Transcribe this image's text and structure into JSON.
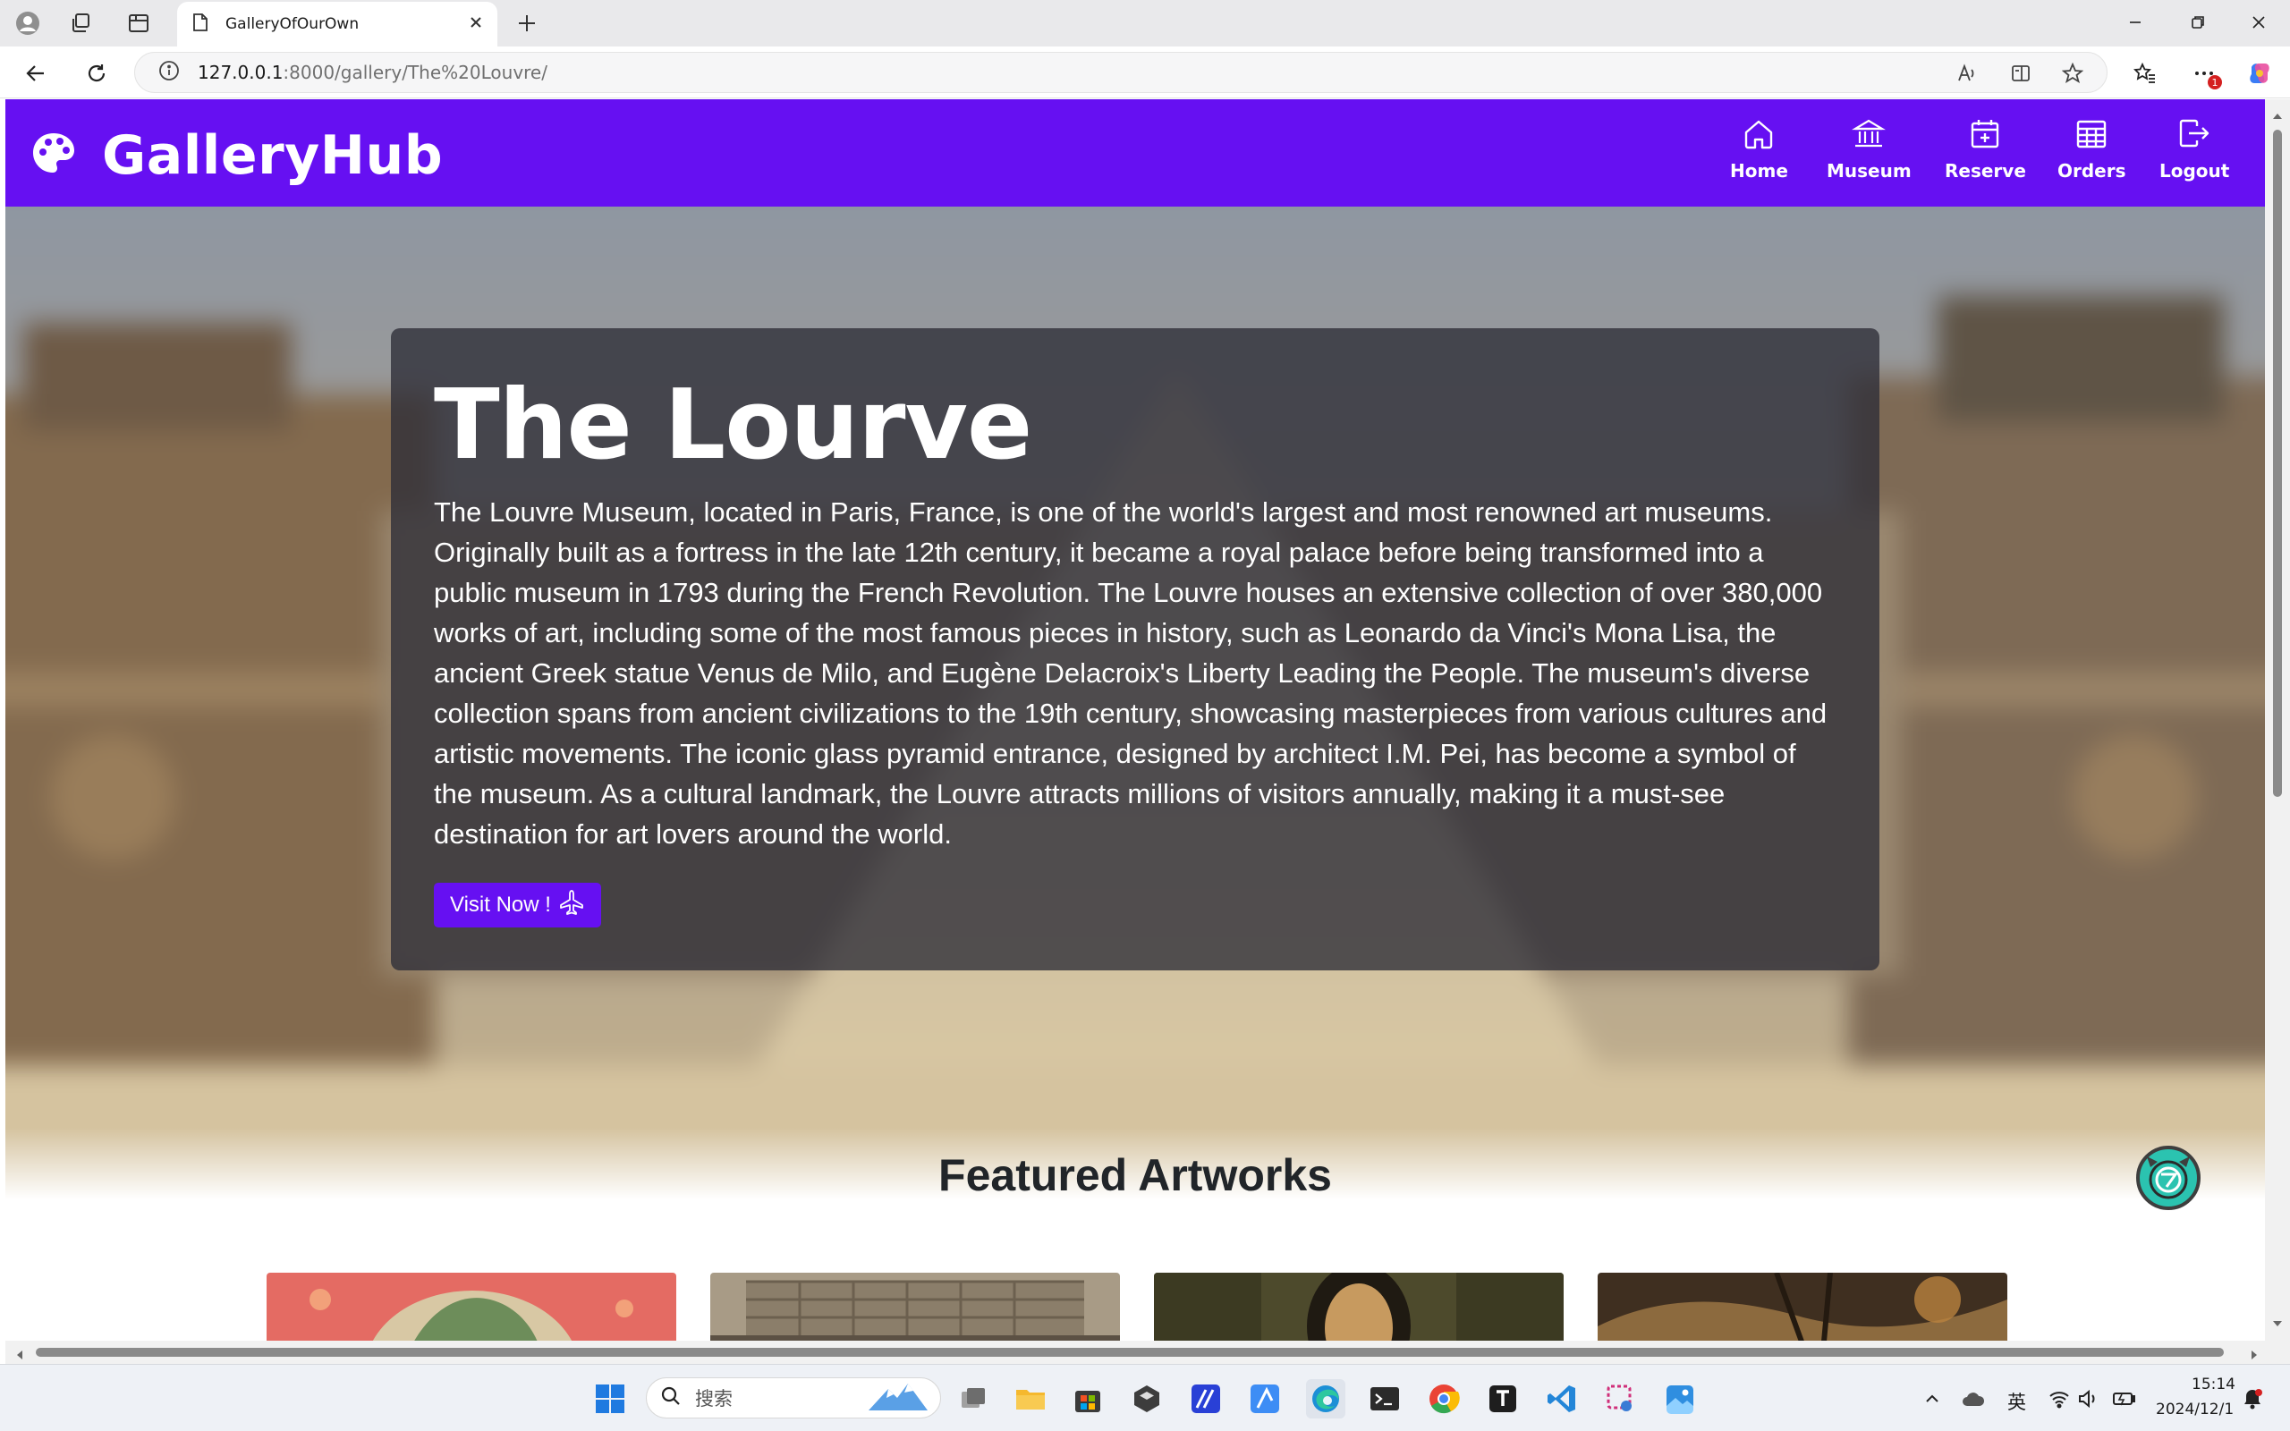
{
  "browser": {
    "tab_title": "GalleryOfOurOwn",
    "url_host": "127.0.0.1",
    "url_rest": ":8000/gallery/The%20Louvre/",
    "notification_count": "1"
  },
  "site": {
    "brand": "GalleryHub",
    "nav": [
      {
        "label": "Home",
        "icon": "home-icon"
      },
      {
        "label": "Museum",
        "icon": "museum-icon"
      },
      {
        "label": "Reserve",
        "icon": "calendar-plus-icon"
      },
      {
        "label": "Orders",
        "icon": "table-icon"
      },
      {
        "label": "Logout",
        "icon": "logout-icon"
      }
    ]
  },
  "hero": {
    "title": "The Lourve",
    "description": "The Louvre Museum, located in Paris, France, is one of the world's largest and most renowned art museums. Originally built as a fortress in the late 12th century, it became a royal palace before being transformed into a public museum in 1793 during the French Revolution. The Louvre houses an extensive collection of over 380,000 works of art, including some of the most famous pieces in history, such as Leonardo da Vinci's Mona Lisa, the ancient Greek statue Venus de Milo, and Eugène Delacroix's Liberty Leading the People. The museum's diverse collection spans from ancient civilizations to the 19th century, showcasing masterpieces from various cultures and artistic movements. The iconic glass pyramid entrance, designed by architect I.M. Pei, has become a symbol of the museum. As a cultural landmark, the Louvre attracts millions of visitors annually, making it a must-see destination for art lovers around the world.",
    "visit_button": "Visit Now !"
  },
  "featured": {
    "title": "Featured Artworks"
  },
  "taskbar": {
    "search_placeholder": "搜索",
    "ime_label": "英",
    "time": "15:14",
    "date": "2024/12/1"
  },
  "colors": {
    "brand_purple": "#6610f2",
    "hero_card": "rgba(45,45,55,0.78)"
  }
}
